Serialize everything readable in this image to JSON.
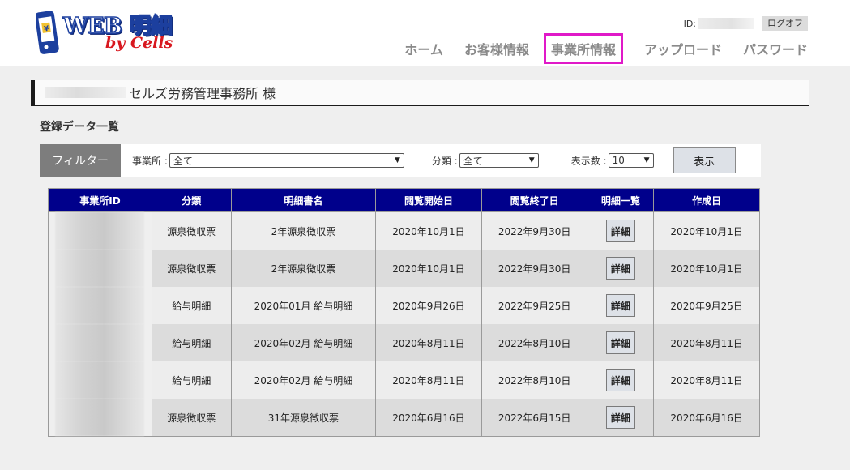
{
  "header": {
    "logo": {
      "line1": "WEB 明細",
      "line2": "by Cells"
    },
    "id_label": "ID:",
    "logout_label": "ログオフ",
    "nav": [
      {
        "label": "ホーム"
      },
      {
        "label": "お客様情報"
      },
      {
        "label": "事業所情報",
        "active": true
      },
      {
        "label": "アップロード"
      },
      {
        "label": "パスワード"
      }
    ]
  },
  "customer": {
    "name": "セルズ労務管理事務所 様"
  },
  "section_title": "登録データ一覧",
  "filter": {
    "label": "フィルター",
    "office_label": "事業所 :",
    "office_value": "全て",
    "category_label": "分類 :",
    "category_value": "全て",
    "count_label": "表示数 :",
    "count_value": "10",
    "show_label": "表示"
  },
  "table": {
    "headers": [
      "事業所ID",
      "分類",
      "明細書名",
      "閲覧開始日",
      "閲覧終了日",
      "明細一覧",
      "作成日"
    ],
    "detail_label": "詳細",
    "rows": [
      {
        "category": "源泉徴収票",
        "name": "2年源泉徴収票",
        "start": "2020年10月1日",
        "end": "2022年9月30日",
        "created": "2020年10月1日"
      },
      {
        "category": "源泉徴収票",
        "name": "2年源泉徴収票",
        "start": "2020年10月1日",
        "end": "2022年9月30日",
        "created": "2020年10月1日"
      },
      {
        "category": "給与明細",
        "name": "2020年01月 給与明細",
        "start": "2020年9月26日",
        "end": "2022年9月25日",
        "created": "2020年9月25日"
      },
      {
        "category": "給与明細",
        "name": "2020年02月 給与明細",
        "start": "2020年8月11日",
        "end": "2022年8月10日",
        "created": "2020年8月11日"
      },
      {
        "category": "給与明細",
        "name": "2020年02月 給与明細",
        "start": "2020年8月11日",
        "end": "2022年8月10日",
        "created": "2020年8月11日"
      },
      {
        "category": "源泉徴収票",
        "name": "31年源泉徴収票",
        "start": "2020年6月16日",
        "end": "2022年6月15日",
        "created": "2020年6月16日"
      }
    ]
  },
  "colors": {
    "table_header": "#00008b",
    "nav_active_border": "#e019c8",
    "logo_blue": "#1c3f9e",
    "logo_red": "#d8181f"
  }
}
